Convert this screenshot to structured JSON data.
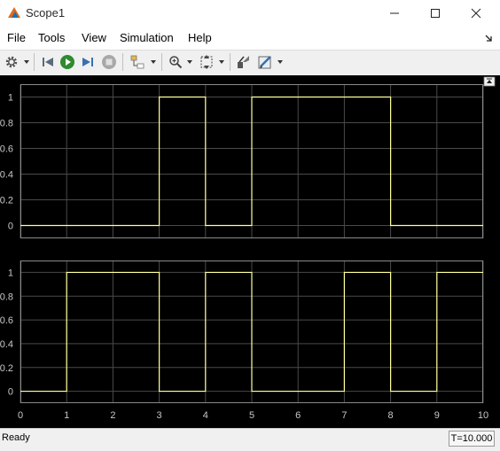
{
  "window": {
    "title": "Scope1"
  },
  "menu": [
    "File",
    "Tools",
    "View",
    "Simulation",
    "Help"
  ],
  "toolbar": {
    "icons": [
      "gear-icon",
      "step-back-icon",
      "run-icon",
      "step-forward-icon",
      "stop-icon",
      "highlight-block-icon",
      "zoom-icon",
      "scale-axes-icon",
      "write-access-icon",
      "style-icon"
    ]
  },
  "scope": {
    "y_ticks": [
      "1",
      "0.8",
      "0.6",
      "0.4",
      "0.2",
      "0"
    ],
    "x_ticks": [
      "0",
      "1",
      "2",
      "3",
      "4",
      "5",
      "6",
      "7",
      "8",
      "9",
      "10"
    ],
    "trace_color": "#ffff99",
    "background": "#000000"
  },
  "chart_data": [
    {
      "type": "line",
      "step": true,
      "x": [
        0,
        1,
        2,
        3,
        4,
        5,
        6,
        7,
        8,
        9,
        10
      ],
      "values": [
        0,
        0,
        0,
        1,
        0,
        1,
        1,
        1,
        0,
        0,
        0
      ],
      "xlim": [
        0,
        10
      ],
      "ylim": [
        -0.1,
        1.1
      ],
      "grid": true
    },
    {
      "type": "line",
      "step": true,
      "x": [
        0,
        1,
        2,
        3,
        4,
        5,
        6,
        7,
        8,
        9,
        10
      ],
      "values": [
        0,
        1,
        1,
        0,
        1,
        0,
        0,
        1,
        0,
        1,
        1
      ],
      "xlim": [
        0,
        10
      ],
      "ylim": [
        -0.1,
        1.1
      ],
      "grid": true
    }
  ],
  "status": {
    "text": "Ready",
    "time": "T=10.000"
  }
}
